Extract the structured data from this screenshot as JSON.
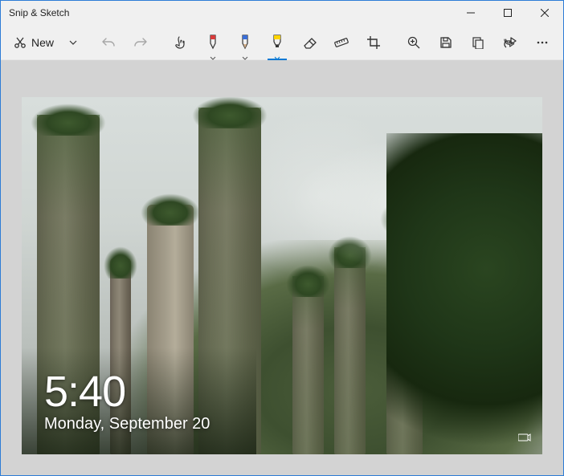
{
  "window": {
    "title": "Snip & Sketch"
  },
  "toolbar": {
    "new_label": "New",
    "icons": {
      "snip": "snip-icon",
      "chevron_down": "chevron-down-icon",
      "undo": "undo-icon",
      "redo": "redo-icon",
      "touch": "touch-writing-icon",
      "ballpoint": "ballpoint-pen-icon",
      "pencil": "pencil-icon",
      "highlighter": "highlighter-icon",
      "eraser": "eraser-icon",
      "ruler": "ruler-icon",
      "crop": "crop-icon",
      "zoom": "zoom-icon",
      "save": "save-icon",
      "copy": "copy-icon",
      "share": "share-icon",
      "more": "more-icon"
    },
    "pen_colors": {
      "ballpoint": "#d83b3b",
      "pencil": "#3a6fd8",
      "highlighter": "#ffd400"
    },
    "selected_tool": "highlighter"
  },
  "canvas": {
    "lock_screen": {
      "time": "5:40",
      "date": "Monday, September 20"
    }
  }
}
